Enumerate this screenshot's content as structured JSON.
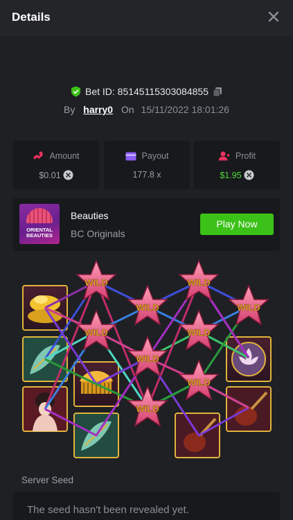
{
  "header": {
    "title": "Details",
    "close_icon": "close-icon"
  },
  "bet": {
    "id_label": "Bet ID: 85145115303084855",
    "by_label": "By",
    "username": "harry0",
    "on_label": "On",
    "datetime": "15/11/2022 18:01:26"
  },
  "stats": {
    "amount": {
      "label": "Amount",
      "value": "$0.01",
      "icon": "bet-amount-icon"
    },
    "payout": {
      "label": "Payout",
      "value": "177.8 x",
      "icon": "wallet-icon"
    },
    "profit": {
      "label": "Profit",
      "value": "$1.95",
      "icon": "profit-user-icon"
    }
  },
  "game": {
    "name": "Beauties",
    "provider": "BC Originals",
    "thumb_text_line1": "ORIENTAL",
    "thumb_text_line2": "BEAUTIES",
    "play_label": "Play Now"
  },
  "board": {
    "wild_label": "WILD",
    "reels": [
      [
        "gold-ingots",
        "guzheng",
        "geisha"
      ],
      [
        "wild",
        "wild",
        "comb",
        "guzheng"
      ],
      [
        "wild",
        "wild",
        "wild"
      ],
      [
        "wild",
        "wild",
        "wild",
        "pipa"
      ],
      [
        "wild",
        "lotus-mirror",
        "pipa"
      ]
    ]
  },
  "server_seed": {
    "label": "Server Seed",
    "value": "The seed hasn't been revealed yet."
  },
  "colors": {
    "accent_green": "#3bc117",
    "profit_green": "#4fd93a",
    "background": "#1e2024",
    "card": "#17191c"
  }
}
